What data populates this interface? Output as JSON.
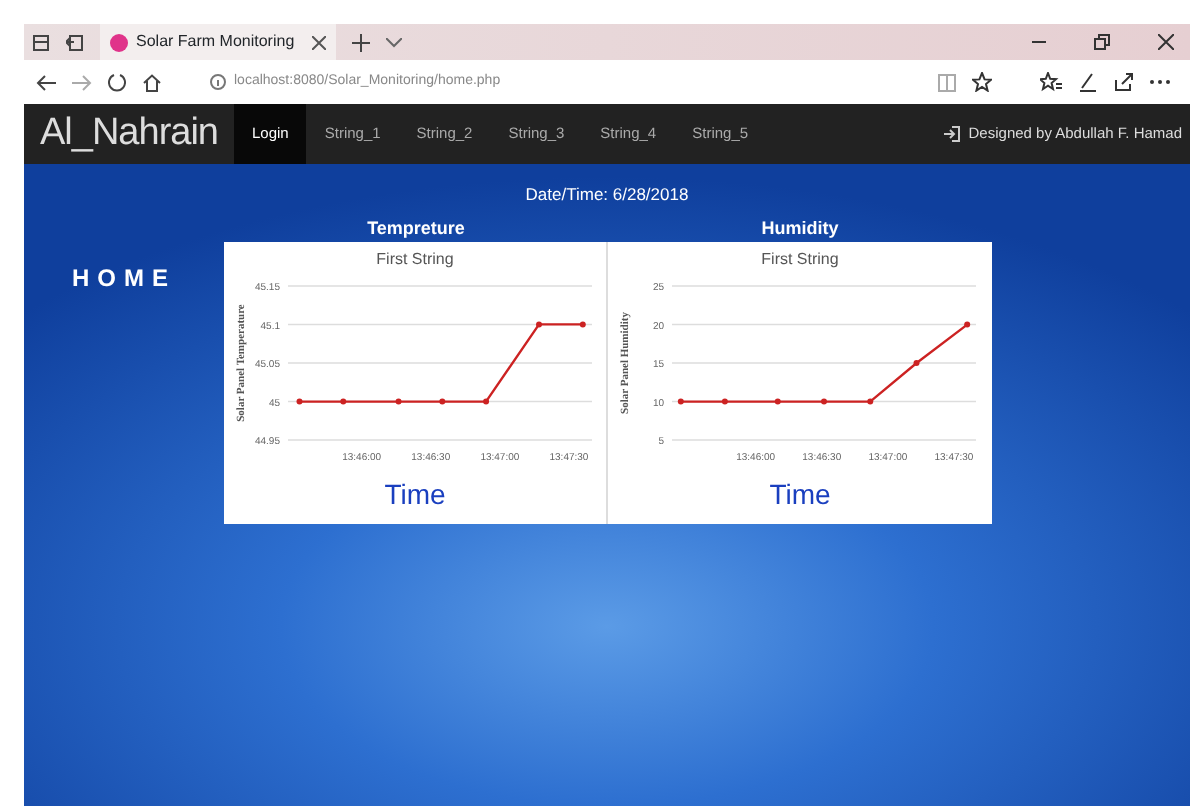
{
  "browser": {
    "tab_title": "Solar Farm Monitoring",
    "address": "localhost:8080/Solar_Monitoring/home.php"
  },
  "navbar": {
    "brand": "Al_Nahrain",
    "items": [
      {
        "label": "Login",
        "selected": true
      },
      {
        "label": "String_1",
        "selected": false
      },
      {
        "label": "String_2",
        "selected": false
      },
      {
        "label": "String_3",
        "selected": false
      },
      {
        "label": "String_4",
        "selected": false
      },
      {
        "label": "String_5",
        "selected": false
      }
    ],
    "credit": "Designed by Abdullah F. Hamad"
  },
  "datetime": "Date/Time: 6/28/2018",
  "home_heading": "HOME",
  "panels": [
    {
      "heading": "Tempreture",
      "chart_data": {
        "type": "line",
        "title": "First String",
        "xlabel": "Time",
        "ylabel": "Solar Panel Temperature",
        "grid": true,
        "x": [
          49533,
          49552,
          49576,
          49595,
          49614,
          49637,
          49656
        ],
        "series": [
          {
            "color": "#cc2222",
            "marker": true,
            "values": [
              45,
              45,
              45,
              45,
              45,
              45.1,
              45.1
            ]
          }
        ],
        "xlim": [
          49528,
          49660
        ],
        "ylim": [
          44.95,
          45.15
        ],
        "xticks": [
          {
            "value": 49560,
            "label": "13:46:00"
          },
          {
            "value": 49590,
            "label": "13:46:30"
          },
          {
            "value": 49620,
            "label": "13:47:00"
          },
          {
            "value": 49650,
            "label": "13:47:30"
          }
        ],
        "yticks": [
          {
            "value": 44.95,
            "label": "44.95"
          },
          {
            "value": 45,
            "label": "45"
          },
          {
            "value": 45.05,
            "label": "45.05"
          },
          {
            "value": 45.1,
            "label": "45.1"
          },
          {
            "value": 45.15,
            "label": "45.15"
          }
        ]
      }
    },
    {
      "heading": "Humidity",
      "chart_data": {
        "type": "line",
        "title": "First String",
        "xlabel": "Time",
        "ylabel": "Solar Panel Humidity",
        "grid": true,
        "x": [
          49526,
          49546,
          49570,
          49591,
          49612,
          49633,
          49656
        ],
        "series": [
          {
            "color": "#cc2222",
            "marker": true,
            "values": [
              10,
              10,
              10,
              10,
              10,
              15,
              20
            ]
          }
        ],
        "xlim": [
          49522,
          49660
        ],
        "ylim": [
          5,
          25
        ],
        "xticks": [
          {
            "value": 49560,
            "label": "13:46:00"
          },
          {
            "value": 49590,
            "label": "13:46:30"
          },
          {
            "value": 49620,
            "label": "13:47:00"
          },
          {
            "value": 49650,
            "label": "13:47:30"
          }
        ],
        "yticks": [
          {
            "value": 5,
            "label": "5"
          },
          {
            "value": 10,
            "label": "10"
          },
          {
            "value": 15,
            "label": "15"
          },
          {
            "value": 20,
            "label": "20"
          },
          {
            "value": 25,
            "label": "25"
          }
        ]
      }
    }
  ]
}
